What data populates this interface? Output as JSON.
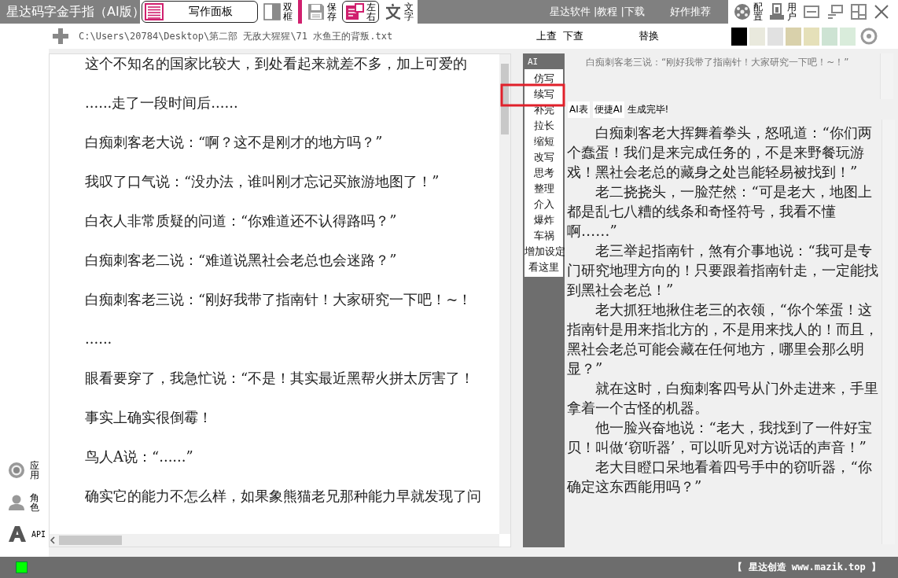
{
  "window": {
    "title": "星达码字金手指（AI版）"
  },
  "toolbar": [
    {
      "kind": "panel",
      "label": "写作面板",
      "selected": true
    },
    {
      "kind": "dual",
      "label": "双框",
      "selected": false
    },
    {
      "kind": "save",
      "label": "保存",
      "selected": false
    },
    {
      "kind": "layout",
      "label": "左右",
      "selected": true
    },
    {
      "kind": "text",
      "label": "文字",
      "selected": false
    }
  ],
  "top_links": [
    "星达软件 |教程 |下载",
    "好作推荐"
  ],
  "window_buttons": [
    {
      "kind": "config",
      "label": "配置"
    },
    {
      "kind": "user",
      "label": "用户"
    },
    {
      "kind": "minimize"
    },
    {
      "kind": "tile"
    },
    {
      "kind": "maximize"
    },
    {
      "kind": "close"
    }
  ],
  "path": "C:\\Users\\20784\\Desktop\\第二部 无敌大猩猩\\71 水鱼王的背叛.txt",
  "find_buttons": [
    "上查",
    "下查"
  ],
  "replace_button": "替换",
  "swatches": [
    {
      "color": "#000000"
    },
    {
      "color": "#e9e9dd"
    },
    {
      "color": "#e1e1e1"
    },
    {
      "color": "#d9d1ab"
    },
    {
      "color": "#e5e0b9"
    },
    {
      "color": "#cde3d3"
    },
    {
      "color": "#d9ecdb"
    }
  ],
  "side_items": [
    {
      "kind": "app",
      "label": "应用"
    },
    {
      "kind": "role",
      "label": "角色"
    },
    {
      "kind": "api",
      "label": "API"
    }
  ],
  "editor": {
    "lines": [
      "这个不知名的国家比较大，到处看起来就差不多，加上可爱的",
      "......走了一段时间后......",
      "白痴刺客老大说：“啊？这不是刚才的地方吗？”",
      "我叹了口气说：“没办法，谁叫刚才忘记买旅游地图了！”",
      "白衣人非常质疑的问道：“你难道还不认得路吗？”",
      "白痴刺客老二说：“难道说黑社会老总也会迷路？”",
      "白痴刺客老三说：“刚好我带了指南针！大家研究一下吧！~！",
      "......",
      "眼看要穿了，我急忙说：“不是！其实最近黑帮火拼太厉害了！",
      "事实上确实很倒霉！",
      "鸟人A说：“......”",
      "确实它的能力不怎么样，如果象熊猫老兄那种能力早就发现了问"
    ]
  },
  "ai_menu": {
    "title": "AI",
    "items": [
      {
        "label": "仿写"
      },
      {
        "label": "续写"
      },
      {
        "label": "补完"
      },
      {
        "label": "拉长"
      },
      {
        "label": "缩短"
      },
      {
        "label": "改写"
      },
      {
        "label": "思考"
      },
      {
        "label": "整理"
      },
      {
        "label": "介入"
      },
      {
        "label": "爆炸"
      },
      {
        "label": "车祸"
      },
      {
        "label": "增加设定"
      },
      {
        "label": "看这里"
      }
    ]
  },
  "ai_panel": {
    "prompt": "白痴刺客老三说：“刚好我带了指南针！大家研究一下吧！~！”",
    "buttons": [
      "AI表",
      "便捷AI"
    ],
    "status": "生成完毕!",
    "paragraphs": [
      "白痴刺客老大挥舞着拳头，怒吼道：“你们两个蠢蛋！我们是来完成任务的，不是来野餐玩游戏！黑社会老总的藏身之处岂能轻易被找到！”",
      "老二挠挠头，一脸茫然：“可是老大，地图上都是乱七八糟的线条和奇怪符号，我看不懂啊……”",
      "老三举起指南针，煞有介事地说：“我可是专门研究地理方向的！只要跟着指南针走，一定能找到黑社会老总！”",
      "老大抓狂地揪住老三的衣领，“你个笨蛋！这指南针是用来指北方的，不是用来找人的！而且，黑社会老总可能会藏在任何地方，哪里会那么明显？”",
      "就在这时，白痴刺客四号从门外走进来，手里拿着一个古怪的机器。",
      "他一脸兴奋地说：“老大，我找到了一件好宝贝！叫做‘窃听器’，可以听见对方说话的声音！”",
      "老大目瞪口呆地看着四号手中的窃听器，“你确定这东西能用吗？”"
    ]
  },
  "status_bar": {
    "credit": "【 星达创造 www.mazik.top 】"
  }
}
